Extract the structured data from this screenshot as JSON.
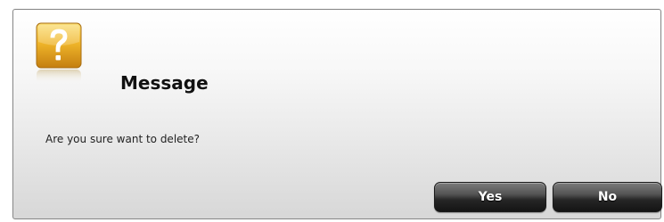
{
  "dialog": {
    "title": "Message",
    "message": "Are you sure want to delete?",
    "icon": "question-mark-icon"
  },
  "buttons": {
    "yes_label": "Yes",
    "no_label": "No"
  },
  "colors": {
    "icon_gold": "#e0a820",
    "button_dark": "#262626",
    "button_text": "#ffffff"
  }
}
